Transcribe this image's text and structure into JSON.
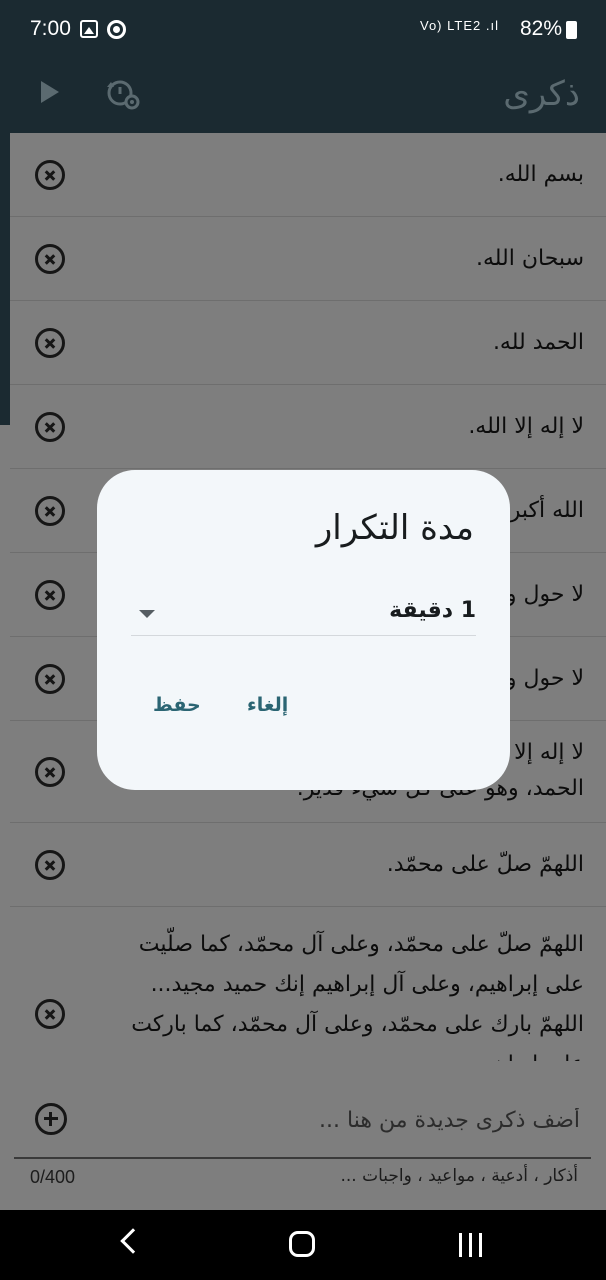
{
  "status": {
    "time": "7:00",
    "signal": "Vo) LTE2 .ıl",
    "battery": "82%"
  },
  "app_bar": {
    "title": "ذكرى"
  },
  "list": {
    "items": [
      {
        "text": "بسم الله."
      },
      {
        "text": "سبحان الله."
      },
      {
        "text": "الحمد لله."
      },
      {
        "text": "لا إله إلا الله."
      },
      {
        "text": "الله أكبر."
      },
      {
        "text": "لا حول ولا قوة إلا بالله."
      },
      {
        "text": "لا حول ولا قوة إلا بالله العلي العظيم."
      },
      {
        "text": "لا إله إلا الله وحده لا شريك له، له الملك وله الحمد، وهو على كل شيء قدير."
      },
      {
        "text": "اللهمّ صلّ على محمّد."
      },
      {
        "text": "اللهمّ صلّ على محمّد، وعلى آل محمّد، كما صلّيت على إبراهيم، وعلى آل إبراهيم إنك حميد مجيد... اللهمّ بارك على محمّد، وعلى آل محمّد، كما باركت على إبراهيم،"
      }
    ]
  },
  "add_area": {
    "placeholder": "أضف ذكرى جديدة من هنا ...",
    "hint": "أذكار ، أدعية ، مواعيد ، واجبات ...",
    "counter": "0/400"
  },
  "dialog": {
    "title": "مدة التكرار",
    "selected_value": "1 دقيقة",
    "cancel_label": "إلغاء",
    "save_label": "حفظ"
  },
  "colors": {
    "app_bar": "#1b2a31",
    "scrim_background": "#7e7e7e",
    "dialog_background": "#f3f7fa",
    "accent": "#2b6573"
  }
}
